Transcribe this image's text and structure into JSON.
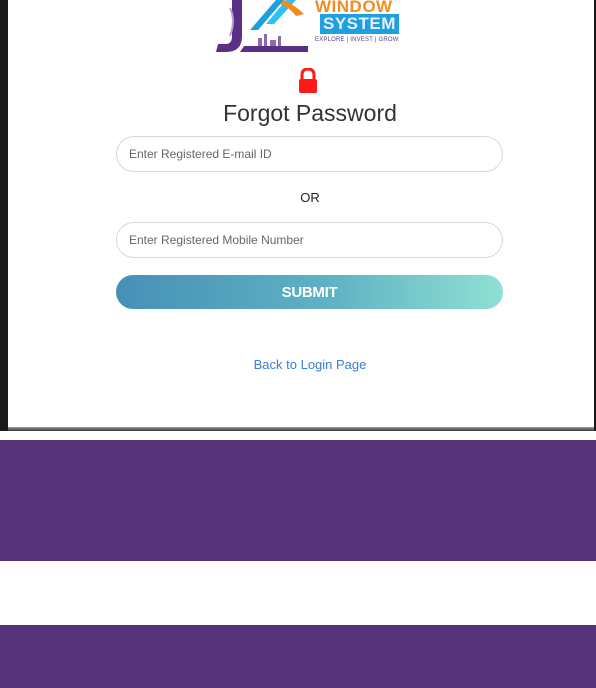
{
  "logo": {
    "line1": "WINDOW",
    "line2": "SYSTEM",
    "tagline": "EXPLORE | INVEST | GROW",
    "mark_icon": "jk-house-logo-icon"
  },
  "lock_icon": "lock-icon",
  "colors": {
    "lock": "#ff1a1a",
    "submit_gradient_start": "#4690b6",
    "submit_gradient_end": "#8fe0d3",
    "link": "#3b7fd6",
    "purple_band": "#573479"
  },
  "form": {
    "title": "Forgot Password",
    "email_placeholder": "Enter Registered E-mail ID",
    "or_label": "OR",
    "mobile_placeholder": "Enter Registered Mobile Number",
    "submit_label": "SUBMIT",
    "back_link": "Back to Login Page"
  }
}
